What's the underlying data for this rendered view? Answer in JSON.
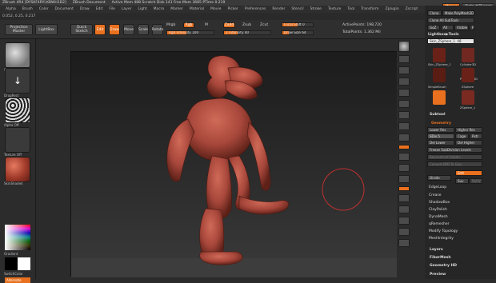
{
  "titlebar": {
    "app": "ZBrush 4R4 [DYSKF4RYI,KBWH1D2]",
    "doc": "ZBrush Document",
    "info": "Active Mem 488  Scratch Disk 141  Free Mem 3685  PTime 0.219"
  },
  "topright": {
    "menus": "Menus",
    "script": "DefaultZScript"
  },
  "menu": [
    "Alpha",
    "Brush",
    "Color",
    "Document",
    "Draw",
    "Edit",
    "File",
    "Layer",
    "Light",
    "Macro",
    "Marker",
    "Material",
    "Movie",
    "Picker",
    "Preferences",
    "Render",
    "Stencil",
    "Stroke",
    "Texture",
    "Tool",
    "Transform",
    "Zplugin",
    "Zscript"
  ],
  "coords": "0.052, 0.25, 0.217",
  "toolbar": {
    "projection_master": "Projection Master",
    "lightbox": "LightBox",
    "quick_sketch": "Quick Sketch",
    "edit": "Edit",
    "draw": "Draw",
    "move": "Move",
    "scale": "Scale",
    "rotate": "Rotate",
    "mrgb": "Mrgb",
    "rgb": "Rgb",
    "m": "M",
    "rgb_intensity": "Rgb Intensity 100",
    "zadd": "Zadd",
    "zsub": "Zsub",
    "zcut": "Zcut",
    "z_intensity": "Z Intensity 40",
    "focal_shift": "Focal Shift 0",
    "draw_size": "Draw Size 64",
    "active_points": "ActivePoints: 198,720",
    "total_points": "TotalPoints: 1.362 Mil"
  },
  "leftshelf": {
    "brush": "Standard",
    "stroke": "DragRect",
    "alpha": "Alpha Off",
    "texture": "Texture Off",
    "material": "SkinShade4",
    "gradient": "Gradient",
    "switch_color": "SwitchColor",
    "alternate": "Alternate"
  },
  "rightpanel": {
    "clone": "Clone",
    "make_polymesh": "Make PolyMesh3D",
    "goz": "GoZ",
    "all": "All",
    "visible": "Visible",
    "r": "R",
    "clone_all_subtools": "Clone All SubTools",
    "lightbox_tools": "Lightbox▶Tools",
    "tool_name": "Skin_ZSphere_1. 48",
    "thumbs": [
      "Skin_ZSphere_1",
      "Cylinder3D",
      "PolyMesh3D",
      "SimpleBrush",
      "ZSphere",
      "ZSphere_1"
    ],
    "subtool": "Subtool",
    "geometry": "Geometry",
    "lower_res": "Lower Res",
    "higher_res": "Higher Res",
    "sdiv": "SDiv 5",
    "cage": "Cage",
    "rstr": "Rstr",
    "del_lower": "Del Lower",
    "del_higher": "Del Higher",
    "freeze": "Freeze SubDivision Levels",
    "reconstruct": "Reconstruct Subdiv",
    "convert_bpr": "Convert BPR To Geo",
    "divide": "Divide",
    "smt": "Smt",
    "suv": "Suv",
    "reuv": "ReUV",
    "items": [
      "EdgeLoop",
      "Crease",
      "ShadowBox",
      "ClayPolish",
      "DynaMesh",
      "qRemesher",
      "Modify Topology",
      "MeshIntegrity"
    ],
    "sections": [
      "Layers",
      "FiberMesh",
      "Geometry HD",
      "Preview"
    ]
  },
  "colors": {
    "accent": "#e8701e",
    "model": "#b04a3c"
  }
}
